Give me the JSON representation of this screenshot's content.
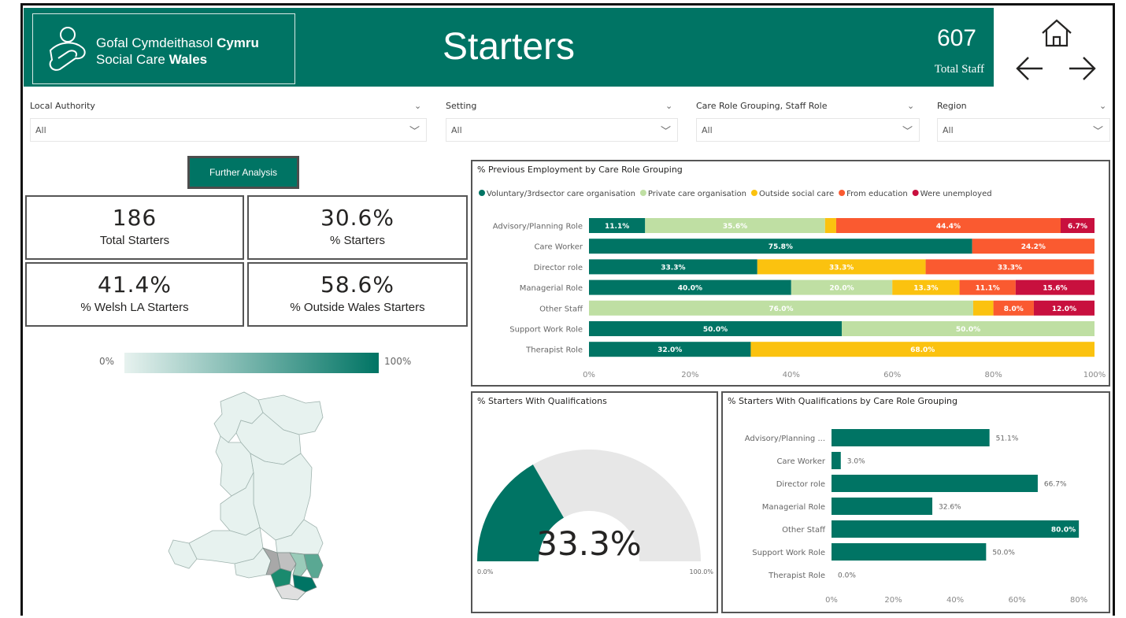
{
  "header": {
    "logo_line1_regular": "Gofal Cymdeithasol ",
    "logo_line1_bold": "Cymru",
    "logo_line2_regular": "Social Care ",
    "logo_line2_bold": "Wales",
    "title": "Starters",
    "total_staff_value": "607",
    "total_staff_label": "Total Staff"
  },
  "nav": {
    "home_icon": "home-icon",
    "back_icon": "arrow-left-icon",
    "forward_icon": "arrow-right-icon"
  },
  "slicers": [
    {
      "label": "Local Authority",
      "value": "All"
    },
    {
      "label": "Setting",
      "value": "All"
    },
    {
      "label": "Care Role Grouping, Staff Role",
      "value": "All"
    },
    {
      "label": "Region",
      "value": "All"
    }
  ],
  "button": {
    "further_analysis": "Further Analysis"
  },
  "kpis": [
    {
      "value": "186",
      "label": "Total Starters"
    },
    {
      "value": "30.6%",
      "label": "% Starters"
    },
    {
      "value": "41.4%",
      "label": "% Welsh LA Starters"
    },
    {
      "value": "58.6%",
      "label": "% Outside Wales Starters"
    }
  ],
  "map_legend": {
    "min": "0%",
    "max": "100%"
  },
  "colors": {
    "brand": "#007464",
    "voluntary": "#007464",
    "private": "#bfdfa3",
    "outside": "#fbc20f",
    "education": "#fa5a30",
    "unemployed": "#c8103e",
    "gauge_bg": "#e7e7e7"
  },
  "chart_data": [
    {
      "type": "bar",
      "stacked": true,
      "orientation": "horizontal",
      "title": "% Previous Employment by Care Role Grouping",
      "categories": [
        "Advisory/Planning Role",
        "Care Worker",
        "Director role",
        "Managerial Role",
        "Other Staff",
        "Support Work Role",
        "Therapist Role"
      ],
      "series": [
        {
          "name": "Voluntary/3rdsector care organisation",
          "values": [
            11.1,
            75.8,
            33.3,
            40.0,
            0,
            50.0,
            32.0
          ]
        },
        {
          "name": "Private care organisation",
          "values": [
            35.6,
            0,
            0,
            20.0,
            76.0,
            50.0,
            0
          ]
        },
        {
          "name": "Outside social care",
          "values": [
            2.2,
            0,
            33.3,
            13.3,
            4.0,
            0,
            68.0
          ]
        },
        {
          "name": "From education",
          "values": [
            44.4,
            24.2,
            33.3,
            11.1,
            8.0,
            0,
            0
          ]
        },
        {
          "name": "Were unemployed",
          "values": [
            6.7,
            0,
            0,
            15.6,
            12.0,
            0,
            0
          ]
        }
      ],
      "labels": [
        [
          "11.1%",
          "35.6%",
          "",
          "44.4%",
          "6.7%"
        ],
        [
          "75.8%",
          "",
          "",
          "24.2%",
          ""
        ],
        [
          "33.3%",
          "",
          "33.3%",
          "33.3%",
          ""
        ],
        [
          "40.0%",
          "20.0%",
          "13.3%",
          "11.1%",
          "15.6%"
        ],
        [
          "",
          "76.0%",
          "",
          "8.0%",
          "12.0%"
        ],
        [
          "50.0%",
          "50.0%",
          "",
          "",
          ""
        ],
        [
          "32.0%",
          "",
          "68.0%",
          "",
          ""
        ]
      ],
      "xticks": [
        "0%",
        "20%",
        "40%",
        "60%",
        "80%",
        "100%"
      ],
      "xlim": [
        0,
        100
      ],
      "legend_position": "top-left"
    },
    {
      "type": "gauge",
      "title": "% Starters With Qualifications",
      "value": 33.3,
      "value_label": "33.3%",
      "min_label": "0.0%",
      "max_label": "100.0%",
      "range": [
        0,
        100
      ]
    },
    {
      "type": "bar",
      "orientation": "horizontal",
      "title": "% Starters With Qualifications by Care Role Grouping",
      "categories": [
        "Advisory/Planning ...",
        "Care Worker",
        "Director role",
        "Managerial Role",
        "Other Staff",
        "Support Work Role",
        "Therapist Role"
      ],
      "values": [
        51.1,
        3.0,
        66.7,
        32.6,
        80.0,
        50.0,
        0.0
      ],
      "labels": [
        "51.1%",
        "3.0%",
        "66.7%",
        "32.6%",
        "80.0%",
        "50.0%",
        "0.0%"
      ],
      "xticks": [
        "0%",
        "20%",
        "40%",
        "60%",
        "80%"
      ],
      "xlim": [
        0,
        82
      ]
    }
  ]
}
